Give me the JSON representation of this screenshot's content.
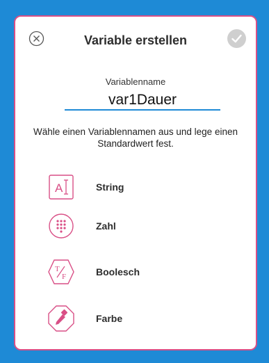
{
  "dialog": {
    "title": "Variable erstellen",
    "close_icon": "close-circle-icon",
    "confirm_icon": "checkmark-icon"
  },
  "name_field": {
    "label": "Variablenname",
    "value": "var1Dauer"
  },
  "hint": "Wähle einen Variablennamen aus und lege einen Standardwert fest.",
  "types": [
    {
      "label": "String",
      "icon": "string-text-cursor-icon"
    },
    {
      "label": "Zahl",
      "icon": "number-keypad-icon"
    },
    {
      "label": "Boolesch",
      "icon": "boolean-true-false-icon"
    },
    {
      "label": "Farbe",
      "icon": "color-dropper-icon"
    }
  ],
  "colors": {
    "background": "#1e8ad6",
    "accent": "#d94f86",
    "input_underline": "#1e8ad6",
    "confirm_disabled": "#cfcfcf"
  }
}
